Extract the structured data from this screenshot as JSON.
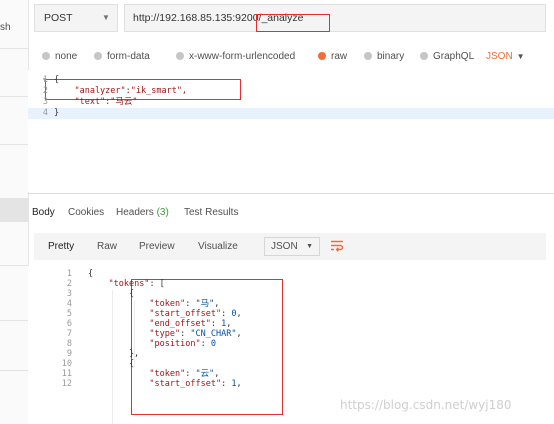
{
  "sidebar": {
    "partial_text": "sh"
  },
  "request": {
    "method": "POST",
    "url": "http://192.168.85.135:9200/_analyze"
  },
  "body_types": [
    "none",
    "form-data",
    "x-www-form-urlencoded",
    "raw",
    "binary",
    "GraphQL"
  ],
  "body_type_selected": "raw",
  "body_format": "JSON",
  "request_body": {
    "line_numbers": [
      "1",
      "2",
      "3",
      "4"
    ],
    "fold_marker": "▾",
    "lines": [
      "{",
      "    \"analyzer\":\"ik_smart\",",
      "    \"text\":\"马云\"",
      "}"
    ]
  },
  "response_tabs": [
    {
      "label": "Body"
    },
    {
      "label": "Cookies"
    },
    {
      "label": "Headers",
      "count": "(3)"
    },
    {
      "label": "Test Results"
    }
  ],
  "response_toolbar": {
    "views": [
      "Pretty",
      "Raw",
      "Preview",
      "Visualize"
    ],
    "format": "JSON"
  },
  "response_body": {
    "line_numbers": [
      "1",
      "2",
      "3",
      "4",
      "5",
      "6",
      "7",
      "8",
      "9",
      "10",
      "11",
      "12"
    ],
    "lines": [
      [
        {
          "t": "{",
          "c": "p"
        }
      ],
      [
        {
          "t": "    ",
          "c": "p"
        },
        {
          "t": "\"tokens\"",
          "c": "k"
        },
        {
          "t": ": [",
          "c": "p"
        }
      ],
      [
        {
          "t": "        {",
          "c": "p"
        }
      ],
      [
        {
          "t": "            ",
          "c": "p"
        },
        {
          "t": "\"token\"",
          "c": "k"
        },
        {
          "t": ": ",
          "c": "p"
        },
        {
          "t": "\"马\"",
          "c": "s"
        },
        {
          "t": ",",
          "c": "p"
        }
      ],
      [
        {
          "t": "            ",
          "c": "p"
        },
        {
          "t": "\"start_offset\"",
          "c": "k"
        },
        {
          "t": ": ",
          "c": "p"
        },
        {
          "t": "0",
          "c": "s"
        },
        {
          "t": ",",
          "c": "p"
        }
      ],
      [
        {
          "t": "            ",
          "c": "p"
        },
        {
          "t": "\"end_offset\"",
          "c": "k"
        },
        {
          "t": ": ",
          "c": "p"
        },
        {
          "t": "1",
          "c": "s"
        },
        {
          "t": ",",
          "c": "p"
        }
      ],
      [
        {
          "t": "            ",
          "c": "p"
        },
        {
          "t": "\"type\"",
          "c": "k"
        },
        {
          "t": ": ",
          "c": "p"
        },
        {
          "t": "\"CN_CHAR\"",
          "c": "s"
        },
        {
          "t": ",",
          "c": "p"
        }
      ],
      [
        {
          "t": "            ",
          "c": "p"
        },
        {
          "t": "\"position\"",
          "c": "k"
        },
        {
          "t": ": ",
          "c": "p"
        },
        {
          "t": "0",
          "c": "s"
        }
      ],
      [
        {
          "t": "        },",
          "c": "p"
        }
      ],
      [
        {
          "t": "        {",
          "c": "p"
        }
      ],
      [
        {
          "t": "            ",
          "c": "p"
        },
        {
          "t": "\"token\"",
          "c": "k"
        },
        {
          "t": ": ",
          "c": "p"
        },
        {
          "t": "\"云\"",
          "c": "s"
        },
        {
          "t": ",",
          "c": "p"
        }
      ],
      [
        {
          "t": "            ",
          "c": "p"
        },
        {
          "t": "\"start_offset\"",
          "c": "k"
        },
        {
          "t": ": ",
          "c": "p"
        },
        {
          "t": "1",
          "c": "s"
        },
        {
          "t": ",",
          "c": "p"
        }
      ]
    ]
  },
  "watermark": "https://blog.csdn.net/wyj180",
  "colors": {
    "accent": "#f26b3a",
    "highlight_box": "#e53030",
    "headers_count": "#3a9a3a"
  }
}
